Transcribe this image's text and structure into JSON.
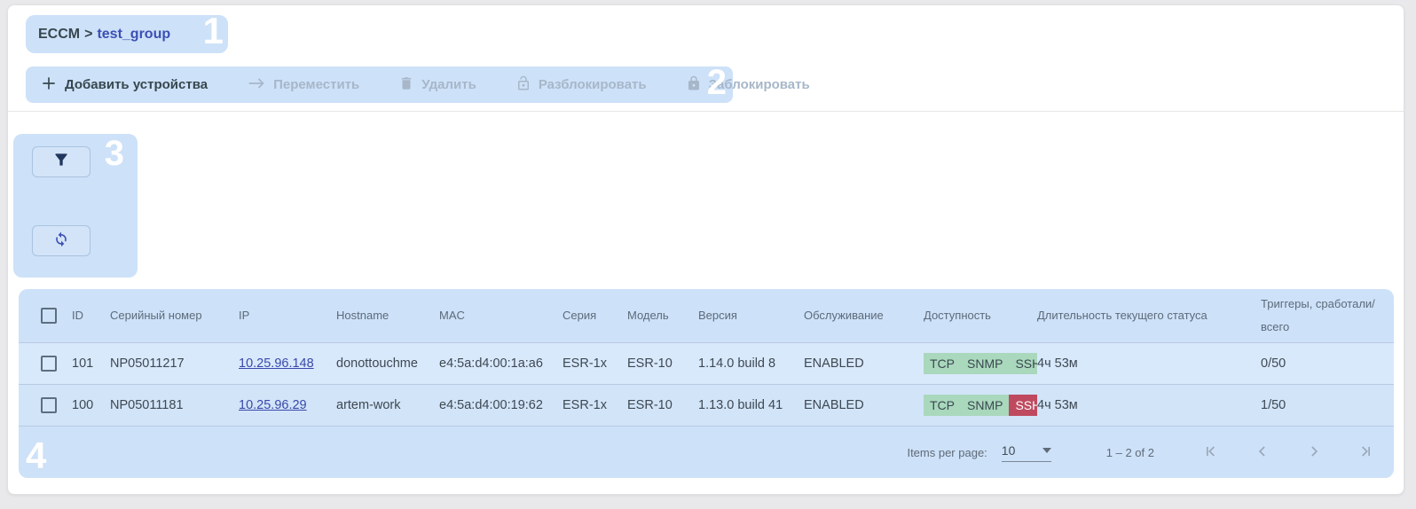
{
  "annotations": {
    "a1": "1",
    "a2": "2",
    "a3": "3",
    "a4": "4"
  },
  "breadcrumb": {
    "root": "ECCM",
    "separator": ">",
    "current": "test_group"
  },
  "toolbar": {
    "buttons": [
      {
        "label": "Добавить устройства",
        "icon": "plus-icon",
        "enabled": true
      },
      {
        "label": "Переместить",
        "icon": "arrow-right-icon",
        "enabled": false
      },
      {
        "label": "Удалить",
        "icon": "trash-icon",
        "enabled": false
      },
      {
        "label": "Разблокировать",
        "icon": "unlock-icon",
        "enabled": false
      },
      {
        "label": "Заблокировать",
        "icon": "lock-icon",
        "enabled": false
      }
    ]
  },
  "filter_panel": {
    "buttons": [
      {
        "icon": "filter-icon"
      },
      {
        "icon": "refresh-icon"
      }
    ]
  },
  "table": {
    "columns": [
      "ID",
      "Серийный номер",
      "IP",
      "Hostname",
      "MAC",
      "Серия",
      "Модель",
      "Версия",
      "Обслуживание",
      "Доступность",
      "Длительность текущего статуса",
      "Триггеры, сработали/всего"
    ],
    "rows": [
      {
        "id": "101",
        "serial": "NP05011217",
        "ip": "10.25.96.148",
        "hostname": "donottouchme",
        "mac": "e4:5a:d4:00:1a:a6",
        "series": "ESR-1x",
        "model": "ESR-10",
        "version": "1.14.0 build 8",
        "maintenance": "ENABLED",
        "availability": [
          {
            "label": "TCP",
            "status": "ok"
          },
          {
            "label": "SNMP",
            "status": "ok"
          },
          {
            "label": "SSH",
            "status": "ok"
          }
        ],
        "duration": "4ч 53м",
        "triggers": "0/50"
      },
      {
        "id": "100",
        "serial": "NP05011181",
        "ip": "10.25.96.29",
        "hostname": "artem-work",
        "mac": "e4:5a:d4:00:19:62",
        "series": "ESR-1x",
        "model": "ESR-10",
        "version": "1.13.0 build 41",
        "maintenance": "ENABLED",
        "availability": [
          {
            "label": "TCP",
            "status": "ok"
          },
          {
            "label": "SNMP",
            "status": "ok"
          },
          {
            "label": "SSH",
            "status": "fail"
          }
        ],
        "duration": "4ч 53м",
        "triggers": "1/50"
      }
    ],
    "footer": {
      "items_per_page_label": "Items per page:",
      "items_per_page_value": "10",
      "range_label": "1 – 2 of 2"
    }
  },
  "colors": {
    "highlight_overlay": "#cde1f8",
    "link": "#3949ab",
    "breadcrumb_current": "#3c50b4",
    "badge_ok_bg": "#a9d8bd",
    "badge_fail_bg": "#bf4a60",
    "toolbar_enabled": "#37474f",
    "toolbar_disabled": "#a7b7c9",
    "refresh_icon": "#3f51b5",
    "filter_icon": "#22375e"
  }
}
